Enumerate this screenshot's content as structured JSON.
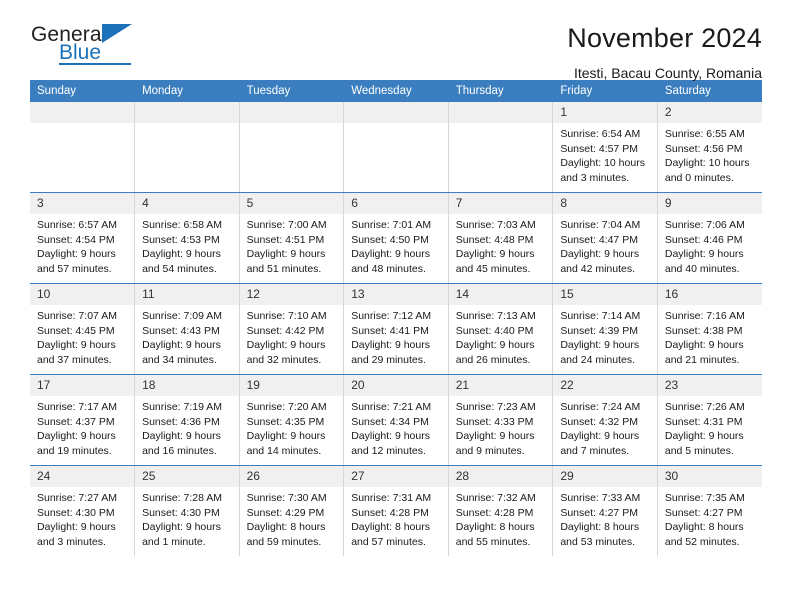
{
  "logo": {
    "word_one": "General",
    "word_two": "Blue",
    "triangle_color": "#1c72b8"
  },
  "header": {
    "title": "November 2024",
    "subtitle": "Itesti, Bacau County, Romania"
  },
  "theme": {
    "header_blue": "#3a7ebf",
    "daynum_band": "#f0f0f0",
    "cell_divider": "#d7d7d7"
  },
  "weekdays": [
    "Sunday",
    "Monday",
    "Tuesday",
    "Wednesday",
    "Thursday",
    "Friday",
    "Saturday"
  ],
  "weeks": [
    [
      {
        "day": "",
        "empty": true
      },
      {
        "day": "",
        "empty": true
      },
      {
        "day": "",
        "empty": true
      },
      {
        "day": "",
        "empty": true
      },
      {
        "day": "",
        "empty": true
      },
      {
        "day": "1",
        "sunrise": "Sunrise: 6:54 AM",
        "sunset": "Sunset: 4:57 PM",
        "daylight_line1": "Daylight: 10 hours",
        "daylight_line2": "and 3 minutes."
      },
      {
        "day": "2",
        "sunrise": "Sunrise: 6:55 AM",
        "sunset": "Sunset: 4:56 PM",
        "daylight_line1": "Daylight: 10 hours",
        "daylight_line2": "and 0 minutes."
      }
    ],
    [
      {
        "day": "3",
        "sunrise": "Sunrise: 6:57 AM",
        "sunset": "Sunset: 4:54 PM",
        "daylight_line1": "Daylight: 9 hours",
        "daylight_line2": "and 57 minutes."
      },
      {
        "day": "4",
        "sunrise": "Sunrise: 6:58 AM",
        "sunset": "Sunset: 4:53 PM",
        "daylight_line1": "Daylight: 9 hours",
        "daylight_line2": "and 54 minutes."
      },
      {
        "day": "5",
        "sunrise": "Sunrise: 7:00 AM",
        "sunset": "Sunset: 4:51 PM",
        "daylight_line1": "Daylight: 9 hours",
        "daylight_line2": "and 51 minutes."
      },
      {
        "day": "6",
        "sunrise": "Sunrise: 7:01 AM",
        "sunset": "Sunset: 4:50 PM",
        "daylight_line1": "Daylight: 9 hours",
        "daylight_line2": "and 48 minutes."
      },
      {
        "day": "7",
        "sunrise": "Sunrise: 7:03 AM",
        "sunset": "Sunset: 4:48 PM",
        "daylight_line1": "Daylight: 9 hours",
        "daylight_line2": "and 45 minutes."
      },
      {
        "day": "8",
        "sunrise": "Sunrise: 7:04 AM",
        "sunset": "Sunset: 4:47 PM",
        "daylight_line1": "Daylight: 9 hours",
        "daylight_line2": "and 42 minutes."
      },
      {
        "day": "9",
        "sunrise": "Sunrise: 7:06 AM",
        "sunset": "Sunset: 4:46 PM",
        "daylight_line1": "Daylight: 9 hours",
        "daylight_line2": "and 40 minutes."
      }
    ],
    [
      {
        "day": "10",
        "sunrise": "Sunrise: 7:07 AM",
        "sunset": "Sunset: 4:45 PM",
        "daylight_line1": "Daylight: 9 hours",
        "daylight_line2": "and 37 minutes."
      },
      {
        "day": "11",
        "sunrise": "Sunrise: 7:09 AM",
        "sunset": "Sunset: 4:43 PM",
        "daylight_line1": "Daylight: 9 hours",
        "daylight_line2": "and 34 minutes."
      },
      {
        "day": "12",
        "sunrise": "Sunrise: 7:10 AM",
        "sunset": "Sunset: 4:42 PM",
        "daylight_line1": "Daylight: 9 hours",
        "daylight_line2": "and 32 minutes."
      },
      {
        "day": "13",
        "sunrise": "Sunrise: 7:12 AM",
        "sunset": "Sunset: 4:41 PM",
        "daylight_line1": "Daylight: 9 hours",
        "daylight_line2": "and 29 minutes."
      },
      {
        "day": "14",
        "sunrise": "Sunrise: 7:13 AM",
        "sunset": "Sunset: 4:40 PM",
        "daylight_line1": "Daylight: 9 hours",
        "daylight_line2": "and 26 minutes."
      },
      {
        "day": "15",
        "sunrise": "Sunrise: 7:14 AM",
        "sunset": "Sunset: 4:39 PM",
        "daylight_line1": "Daylight: 9 hours",
        "daylight_line2": "and 24 minutes."
      },
      {
        "day": "16",
        "sunrise": "Sunrise: 7:16 AM",
        "sunset": "Sunset: 4:38 PM",
        "daylight_line1": "Daylight: 9 hours",
        "daylight_line2": "and 21 minutes."
      }
    ],
    [
      {
        "day": "17",
        "sunrise": "Sunrise: 7:17 AM",
        "sunset": "Sunset: 4:37 PM",
        "daylight_line1": "Daylight: 9 hours",
        "daylight_line2": "and 19 minutes."
      },
      {
        "day": "18",
        "sunrise": "Sunrise: 7:19 AM",
        "sunset": "Sunset: 4:36 PM",
        "daylight_line1": "Daylight: 9 hours",
        "daylight_line2": "and 16 minutes."
      },
      {
        "day": "19",
        "sunrise": "Sunrise: 7:20 AM",
        "sunset": "Sunset: 4:35 PM",
        "daylight_line1": "Daylight: 9 hours",
        "daylight_line2": "and 14 minutes."
      },
      {
        "day": "20",
        "sunrise": "Sunrise: 7:21 AM",
        "sunset": "Sunset: 4:34 PM",
        "daylight_line1": "Daylight: 9 hours",
        "daylight_line2": "and 12 minutes."
      },
      {
        "day": "21",
        "sunrise": "Sunrise: 7:23 AM",
        "sunset": "Sunset: 4:33 PM",
        "daylight_line1": "Daylight: 9 hours",
        "daylight_line2": "and 9 minutes."
      },
      {
        "day": "22",
        "sunrise": "Sunrise: 7:24 AM",
        "sunset": "Sunset: 4:32 PM",
        "daylight_line1": "Daylight: 9 hours",
        "daylight_line2": "and 7 minutes."
      },
      {
        "day": "23",
        "sunrise": "Sunrise: 7:26 AM",
        "sunset": "Sunset: 4:31 PM",
        "daylight_line1": "Daylight: 9 hours",
        "daylight_line2": "and 5 minutes."
      }
    ],
    [
      {
        "day": "24",
        "sunrise": "Sunrise: 7:27 AM",
        "sunset": "Sunset: 4:30 PM",
        "daylight_line1": "Daylight: 9 hours",
        "daylight_line2": "and 3 minutes."
      },
      {
        "day": "25",
        "sunrise": "Sunrise: 7:28 AM",
        "sunset": "Sunset: 4:30 PM",
        "daylight_line1": "Daylight: 9 hours",
        "daylight_line2": "and 1 minute."
      },
      {
        "day": "26",
        "sunrise": "Sunrise: 7:30 AM",
        "sunset": "Sunset: 4:29 PM",
        "daylight_line1": "Daylight: 8 hours",
        "daylight_line2": "and 59 minutes."
      },
      {
        "day": "27",
        "sunrise": "Sunrise: 7:31 AM",
        "sunset": "Sunset: 4:28 PM",
        "daylight_line1": "Daylight: 8 hours",
        "daylight_line2": "and 57 minutes."
      },
      {
        "day": "28",
        "sunrise": "Sunrise: 7:32 AM",
        "sunset": "Sunset: 4:28 PM",
        "daylight_line1": "Daylight: 8 hours",
        "daylight_line2": "and 55 minutes."
      },
      {
        "day": "29",
        "sunrise": "Sunrise: 7:33 AM",
        "sunset": "Sunset: 4:27 PM",
        "daylight_line1": "Daylight: 8 hours",
        "daylight_line2": "and 53 minutes."
      },
      {
        "day": "30",
        "sunrise": "Sunrise: 7:35 AM",
        "sunset": "Sunset: 4:27 PM",
        "daylight_line1": "Daylight: 8 hours",
        "daylight_line2": "and 52 minutes."
      }
    ]
  ]
}
